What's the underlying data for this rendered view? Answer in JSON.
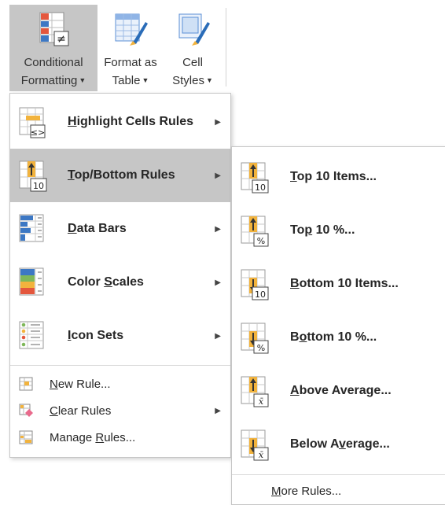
{
  "ribbon": {
    "conditional_formatting": {
      "line1": "Conditional",
      "line2": "Formatting"
    },
    "format_as_table": {
      "line1": "Format as",
      "line2": "Table"
    },
    "cell_styles": {
      "line1": "Cell",
      "line2": "Styles"
    }
  },
  "menu": {
    "items": [
      {
        "pre": "",
        "key": "H",
        "post": "ighlight Cells Rules",
        "icon": "highlight-cells-rules-icon"
      },
      {
        "pre": "",
        "key": "T",
        "post": "op/Bottom Rules",
        "icon": "top-bottom-rules-icon"
      },
      {
        "pre": "",
        "key": "D",
        "post": "ata Bars",
        "icon": "data-bars-icon"
      },
      {
        "pre": "Color ",
        "key": "S",
        "post": "cales",
        "icon": "color-scales-icon"
      },
      {
        "pre": "",
        "key": "I",
        "post": "con Sets",
        "icon": "icon-sets-icon"
      }
    ],
    "small_items": [
      {
        "pre": "",
        "key": "N",
        "post": "ew Rule...",
        "icon": "new-rule-icon"
      },
      {
        "pre": "",
        "key": "C",
        "post": "lear Rules",
        "icon": "clear-rules-icon"
      },
      {
        "pre": "Manage ",
        "key": "R",
        "post": "ules...",
        "icon": "manage-rules-icon"
      }
    ]
  },
  "submenu": {
    "items": [
      {
        "pre": "",
        "key": "T",
        "post": "op 10 Items...",
        "badge": "10"
      },
      {
        "pre": "To",
        "key": "p",
        "post": " 10 %...",
        "badge": "%"
      },
      {
        "pre": "",
        "key": "B",
        "post": "ottom 10 Items...",
        "badge": "10"
      },
      {
        "pre": "B",
        "key": "o",
        "post": "ttom 10 %...",
        "badge": "%"
      },
      {
        "pre": "",
        "key": "A",
        "post": "bove Average...",
        "badge": "x̄"
      },
      {
        "pre": "Below A",
        "key": "v",
        "post": "erage...",
        "badge": "x̄"
      }
    ],
    "more": {
      "pre": "",
      "key": "M",
      "post": "ore Rules..."
    }
  },
  "colors": {
    "highlight": "#c6c6c6",
    "icon_orange": "#f2b33d",
    "icon_blue": "#3d78c4",
    "icon_red": "#e4573d"
  }
}
